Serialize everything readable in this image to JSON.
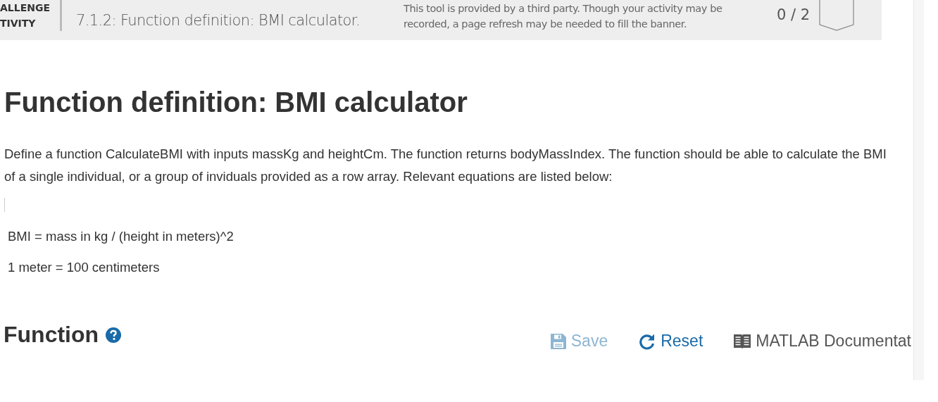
{
  "banner": {
    "label_lines": [
      "ALLENGE",
      "TIVITY"
    ],
    "title": "7.1.2: Function definition: BMI calculator.",
    "note": "This tool is provided by a third party. Though your activity may be recorded, a page refresh may be needed to fill the banner.",
    "progress": "0 / 2"
  },
  "heading": "Function definition: BMI calculator",
  "description": "Define a function CalculateBMI with inputs massKg and heightCm. The function returns bodyMassIndex. The function should be able to calculate the BMI of a single individual, or a group of inviduals provided as a row array. Relevant equations are listed below:",
  "equations": [
    "BMI = mass in kg / (height in meters)^2",
    "1 meter = 100 centimeters"
  ],
  "section": {
    "title": "Function"
  },
  "toolbar": [
    {
      "kind": "save",
      "label": "Save",
      "disabled": true
    },
    {
      "kind": "reset",
      "label": "Reset",
      "disabled": false
    },
    {
      "kind": "docs",
      "label": "MATLAB Documentat",
      "disabled": false
    }
  ]
}
